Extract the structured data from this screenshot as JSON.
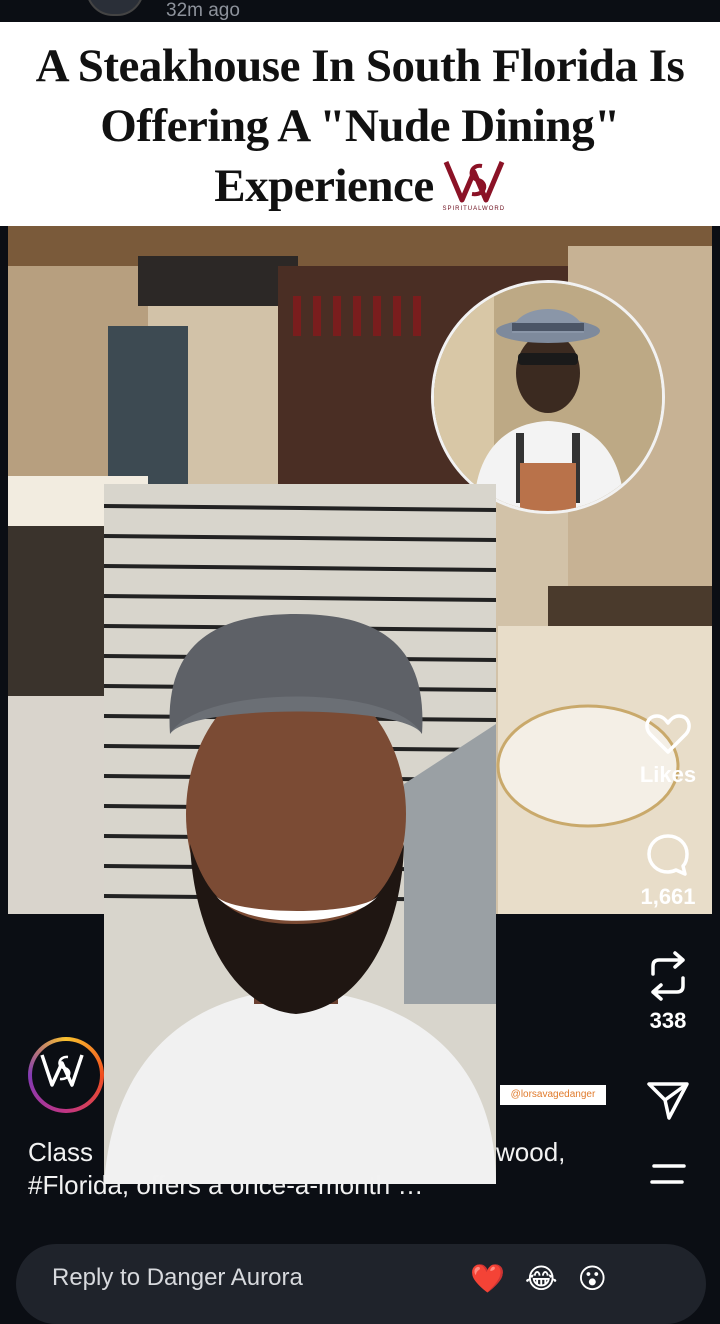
{
  "post": {
    "timestamp": "32m ago",
    "headline": "A Steakhouse In South Florida Is Offering A \"Nude Dining\" Experience",
    "logo_caption": "SPIRITUALWORD",
    "overlay_tag": "@lorsavagedanger",
    "caption_left": "Class",
    "caption_right": "wood,",
    "caption_line2": "#Florida, offers a once-a-month …"
  },
  "actions": {
    "likes_label": "Likes",
    "comments_count": "1,661",
    "reposts_count": "338"
  },
  "reply": {
    "placeholder": "Reply to Danger Aurora",
    "emojis": [
      "❤️",
      "😂",
      "😮"
    ]
  },
  "icons": [
    "heart-icon",
    "comment-icon",
    "repost-icon",
    "share-icon",
    "menu-icon"
  ],
  "colors": {
    "background": "#0b0e14",
    "headline_bg": "#ffffff",
    "brand": "#8b1226"
  }
}
